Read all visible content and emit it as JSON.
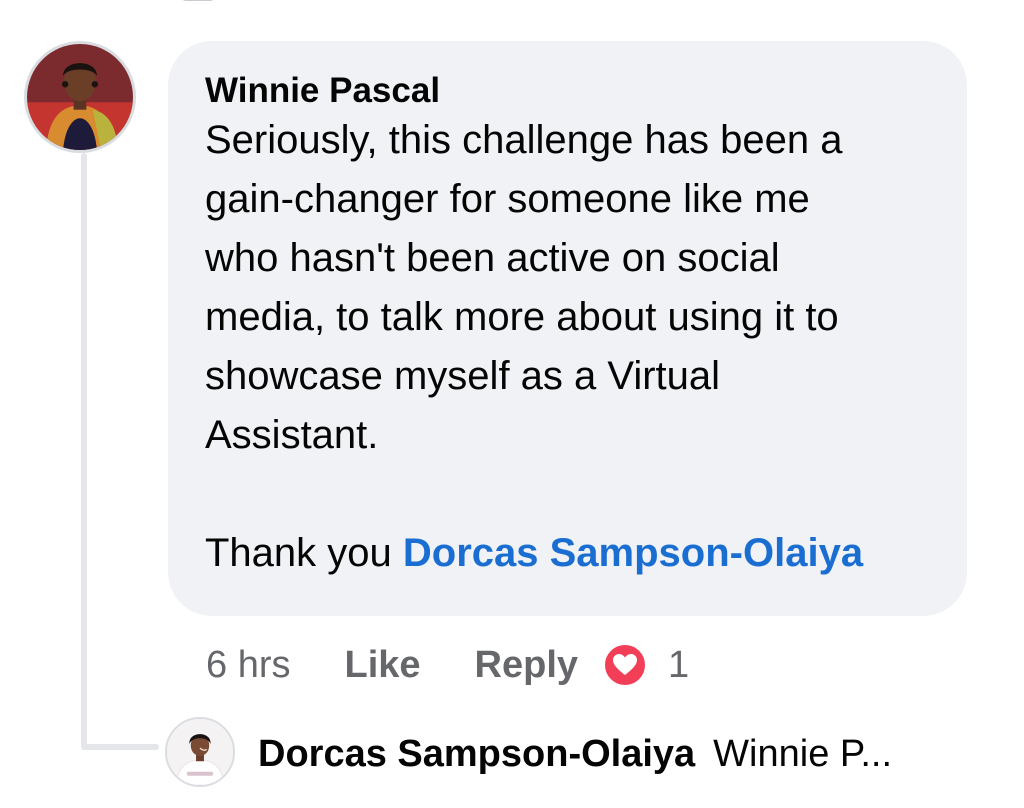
{
  "comment": {
    "author": "Winnie Pascal",
    "text_lines": [
      "Seriously, this challenge has been a",
      "gain-changer for someone like me",
      "who hasn't been active on social",
      "media, to talk more about using it to",
      "showcase myself as a Virtual",
      "Assistant."
    ],
    "thanks_prefix": "Thank you ",
    "mention": "Dorcas Sampson-Olaiya",
    "timestamp": "6 hrs",
    "like_label": "Like",
    "reply_label": "Reply",
    "reaction_icon": "love-reaction-icon",
    "reaction_count": "1"
  },
  "reply_preview": {
    "author": "Dorcas Sampson-Olaiya",
    "snippet": "Winnie P..."
  },
  "colors": {
    "bubble_bg": "#f0f2f5",
    "mention": "#1b6ed1",
    "meta_text": "#65676b",
    "love_reaction": "#f33e58"
  }
}
